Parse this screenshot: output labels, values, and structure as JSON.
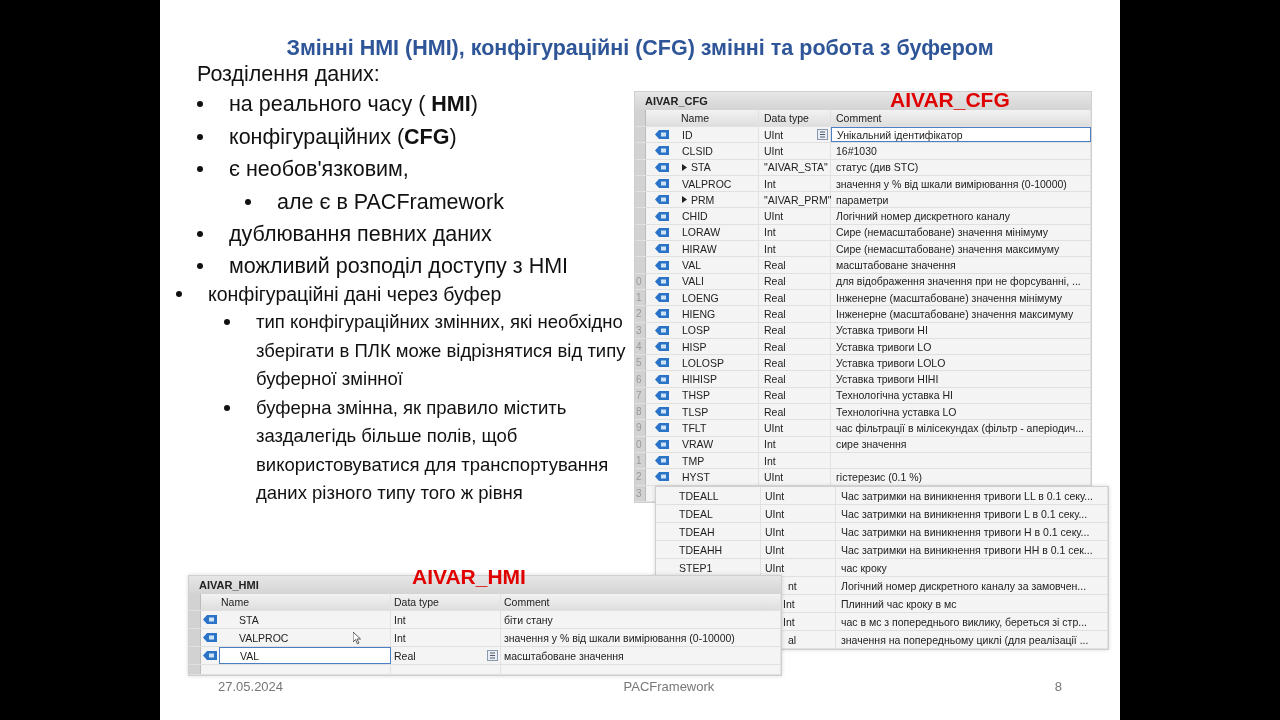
{
  "slide": {
    "title": "Змінні HMI (HMI), конфігураційні (CFG) змінні та робота з буфером",
    "intro": "Розділення даних:",
    "bullets": [
      {
        "text": "на реального часу ( **HMI**)"
      },
      {
        "text": "конфігураційних (**CFG**)"
      },
      {
        "text": "є необов'язковим,",
        "children": [
          {
            "text": "але є в PACFramework"
          }
        ]
      },
      {
        "text": "дублювання певних даних"
      },
      {
        "text": "можливий розподіл доступу з HMI"
      }
    ],
    "buffer_bullet": {
      "text": "конфігураційні дані через буфер",
      "children": [
        {
          "text": "тип конфігураційних змінних, які необхідно зберігати в ПЛК може відрізнятися від типу буферної змінної"
        },
        {
          "text": "буферна змінна, як правило містить заздалегідь більше полів, щоб використовуватися для транспортування даних різного типу того ж рівня"
        }
      ]
    },
    "footer": {
      "date": "27.05.2024",
      "center": "PACFramework",
      "page": "8"
    }
  },
  "cfg_table": {
    "title": "AIVAR_CFG",
    "caption": "AIVAR_CFG",
    "columns": [
      "Name",
      "Data type",
      "Comment"
    ],
    "rows": [
      {
        "name": "ID",
        "data_type": "UInt",
        "comment": "Унікальний ідентифікатор",
        "expandable": false,
        "selected": true
      },
      {
        "name": "CLSID",
        "data_type": "UInt",
        "comment": "16#1030",
        "expandable": false,
        "selected": false
      },
      {
        "name": "STA",
        "data_type": "\"AIVAR_STA\"",
        "comment": "статус (див STC)",
        "expandable": true,
        "selected": false
      },
      {
        "name": "VALPROC",
        "data_type": "Int",
        "comment": "значення у % від шкали вимірювання (0-10000)",
        "expandable": false,
        "selected": false
      },
      {
        "name": "PRM",
        "data_type": "\"AIVAR_PRM\"",
        "comment": "параметри",
        "expandable": true,
        "selected": false
      },
      {
        "name": "CHID",
        "data_type": "UInt",
        "comment": "Логічний номер дискретного каналу",
        "expandable": false,
        "selected": false
      },
      {
        "name": "LORAW",
        "data_type": "Int",
        "comment": "Сире (немасштабоване) значення мінімуму",
        "expandable": false,
        "selected": false
      },
      {
        "name": "HIRAW",
        "data_type": "Int",
        "comment": "Сире (немасштабоване) значення максимуму",
        "expandable": false,
        "selected": false
      },
      {
        "name": "VAL",
        "data_type": "Real",
        "comment": "масштабоване значення",
        "expandable": false,
        "selected": false
      },
      {
        "row_number": "0",
        "name": "VALI",
        "data_type": "Real",
        "comment": "для відображення значення при не форсуванні, ...",
        "expandable": false,
        "selected": false
      },
      {
        "row_number": "1",
        "name": "LOENG",
        "data_type": "Real",
        "comment": "Інженерне (масштабоване) значення мінімуму",
        "expandable": false,
        "selected": false
      },
      {
        "row_number": "2",
        "name": "HIENG",
        "data_type": "Real",
        "comment": "Інженерне (масштабоване) значення максимуму",
        "expandable": false,
        "selected": false
      },
      {
        "row_number": "3",
        "name": "LOSP",
        "data_type": "Real",
        "comment": "Уставка тривоги HI",
        "expandable": false,
        "selected": false
      },
      {
        "row_number": "4",
        "name": "HISP",
        "data_type": "Real",
        "comment": "Уставка тривоги LO",
        "expandable": false,
        "selected": false
      },
      {
        "row_number": "5",
        "name": "LOLOSP",
        "data_type": "Real",
        "comment": "Уставка тривоги LOLO",
        "expandable": false,
        "selected": false
      },
      {
        "row_number": "6",
        "name": "HIHISP",
        "data_type": "Real",
        "comment": "Уставка тривоги HIHI",
        "expandable": false,
        "selected": false
      },
      {
        "row_number": "7",
        "name": "THSP",
        "data_type": "Real",
        "comment": "Технологічна уставка HI",
        "expandable": false,
        "selected": false
      },
      {
        "row_number": "8",
        "name": "TLSP",
        "data_type": "Real",
        "comment": "Технологічна уставка LO",
        "expandable": false,
        "selected": false
      },
      {
        "row_number": "9",
        "name": "TFLT",
        "data_type": "UInt",
        "comment": "час фільтрації в мілісекундах (фільтр - аперіодич...",
        "expandable": false,
        "selected": false
      },
      {
        "row_number": "0",
        "name": "VRAW",
        "data_type": "Int",
        "comment": "сире значення",
        "expandable": false,
        "selected": false
      },
      {
        "row_number": "1",
        "name": "TMP",
        "data_type": "Int",
        "expandable": false,
        "selected": false
      },
      {
        "row_number": "2",
        "name": "HYST",
        "data_type": "UInt",
        "comment": "гістерезис (0.1 %)",
        "expandable": false,
        "selected": false
      },
      {
        "row_number": "3"
      }
    ]
  },
  "cfg_continuation": {
    "rows": [
      {
        "name": "TDEALL",
        "data_type": "UInt",
        "comment": "Час затримки на виникнення тривоги LL в 0.1 секу...",
        "covered": false
      },
      {
        "name": "TDEAL",
        "data_type": "UInt",
        "comment": "Час затримки на виникнення тривоги L в 0.1 секу...",
        "covered": false
      },
      {
        "name": "TDEAH",
        "data_type": "UInt",
        "comment": "Час затримки на виникнення тривоги H в 0.1 секу...",
        "covered": false
      },
      {
        "name": "TDEAHH",
        "data_type": "UInt",
        "comment": "Час затримки на виникнення тривоги HH в 0.1 сек...",
        "covered": false
      },
      {
        "name": "STEP1",
        "data_type": "UInt",
        "comment": "час кроку",
        "covered": false
      },
      {
        "data_type": "nt",
        "comment": "Логічний номер дискретного каналу за замовчен...",
        "covered": true
      },
      {
        "data_type": "Int",
        "comment": "Плинний час кроку в мс",
        "covered": true
      },
      {
        "data_type": "Int",
        "comment": "час в мс з попереднього виклику, береться зі стр...",
        "covered": true
      },
      {
        "data_type": "al",
        "comment": "значення на попередньому циклі (для реалізації ...",
        "covered": true
      }
    ]
  },
  "hmi_table": {
    "title": "AIVAR_HMI",
    "caption": "AIVAR_HMI",
    "columns": [
      "Name",
      "Data type",
      "Comment"
    ],
    "rows": [
      {
        "name": "STA",
        "data_type": "Int",
        "comment": "біти стану",
        "selected": false
      },
      {
        "name": "VALPROC",
        "data_type": "Int",
        "comment": "значення у % від шкали вимірювання (0-10000)",
        "selected": false
      },
      {
        "name": "VAL",
        "data_type": "Real",
        "comment": "масштабоване значення",
        "selected": true
      }
    ]
  }
}
